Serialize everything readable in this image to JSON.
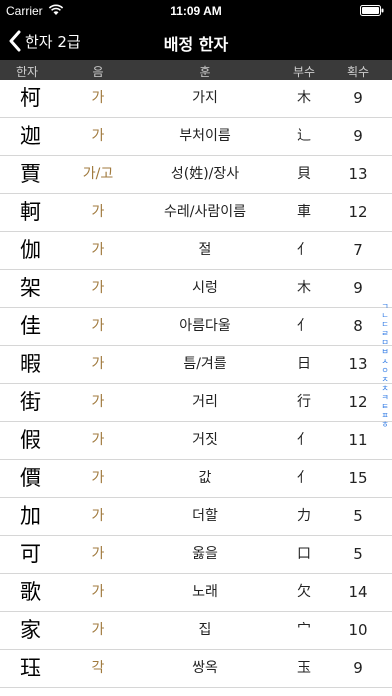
{
  "status_bar": {
    "carrier": "Carrier",
    "time": "11:09 AM"
  },
  "nav": {
    "back_label": "한자 2급",
    "title": "배정 한자"
  },
  "table": {
    "headers": [
      "한자",
      "음",
      "훈",
      "부수",
      "획수"
    ],
    "rows": [
      {
        "hanja": "柯",
        "eum": "가",
        "hun": "가지",
        "busu": "木",
        "hoek": "9"
      },
      {
        "hanja": "迦",
        "eum": "가",
        "hun": "부처이름",
        "busu": "辶",
        "hoek": "9"
      },
      {
        "hanja": "賈",
        "eum": "가/고",
        "hun": "성(姓)/장사",
        "busu": "貝",
        "hoek": "13"
      },
      {
        "hanja": "軻",
        "eum": "가",
        "hun": "수레/사람이름",
        "busu": "車",
        "hoek": "12"
      },
      {
        "hanja": "伽",
        "eum": "가",
        "hun": "절",
        "busu": "亻",
        "hoek": "7"
      },
      {
        "hanja": "架",
        "eum": "가",
        "hun": "시렁",
        "busu": "木",
        "hoek": "9"
      },
      {
        "hanja": "佳",
        "eum": "가",
        "hun": "아름다울",
        "busu": "亻",
        "hoek": "8"
      },
      {
        "hanja": "暇",
        "eum": "가",
        "hun": "틈/겨를",
        "busu": "日",
        "hoek": "13"
      },
      {
        "hanja": "街",
        "eum": "가",
        "hun": "거리",
        "busu": "行",
        "hoek": "12"
      },
      {
        "hanja": "假",
        "eum": "가",
        "hun": "거짓",
        "busu": "亻",
        "hoek": "11"
      },
      {
        "hanja": "價",
        "eum": "가",
        "hun": "값",
        "busu": "亻",
        "hoek": "15"
      },
      {
        "hanja": "加",
        "eum": "가",
        "hun": "더할",
        "busu": "力",
        "hoek": "5"
      },
      {
        "hanja": "可",
        "eum": "가",
        "hun": "옳을",
        "busu": "口",
        "hoek": "5"
      },
      {
        "hanja": "歌",
        "eum": "가",
        "hun": "노래",
        "busu": "欠",
        "hoek": "14"
      },
      {
        "hanja": "家",
        "eum": "가",
        "hun": "집",
        "busu": "宀",
        "hoek": "10"
      },
      {
        "hanja": "珏",
        "eum": "각",
        "hun": "쌍옥",
        "busu": "玉",
        "hoek": "9"
      }
    ]
  },
  "index_bar": [
    "ㄱ",
    "ㄴ",
    "ㄷ",
    "ㄹ",
    "ㅁ",
    "ㅂ",
    "ㅅ",
    "ㅇ",
    "ㅈ",
    "ㅊ",
    "ㅋ",
    "ㅌ",
    "ㅍ",
    "ㅎ"
  ],
  "colors": {
    "bar_background": "#000000",
    "header_background": "#3a3a3a",
    "eum_text": "#a07a3e",
    "index_text": "#2f7ae5"
  }
}
